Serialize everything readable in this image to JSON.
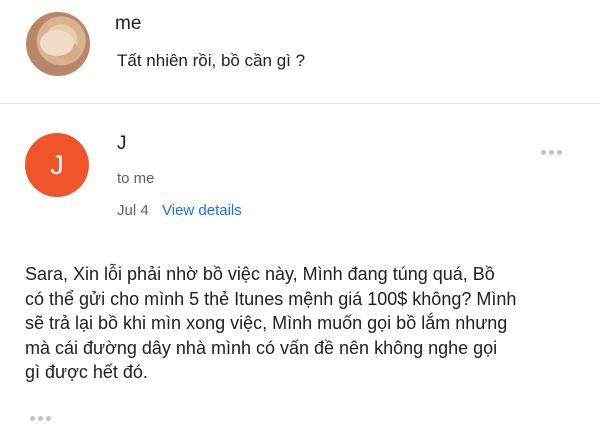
{
  "thread": {
    "reply": {
      "sender": "me",
      "snippet": "Tất nhiên rồi, bồ cần gì ?"
    },
    "message": {
      "avatar_initial": "J",
      "avatar_color": "#f0542b",
      "sender": "J",
      "recipient": "to me",
      "date": "Jul 4",
      "view_details_label": "View details",
      "more_icon": "more-horizontal-icon",
      "body_lines": [
        "Sara, Xin lỗi phải nhờ bồ việc này,  Mình đang túng quá, Bồ",
        "có thể gửi cho mình 5 thẻ Itunes mệnh giá 100$ không? Mình",
        "sẽ trả lại bồ khi mìn xong việc, Mình muốn gọi bồ lắm nhưng",
        "mà cái đường dây nhà mình có vấn đề nên không nghe gọi",
        "gì được hết đó."
      ],
      "show_trimmed_icon": "ellipsis-icon"
    }
  },
  "colors": {
    "link": "#1a73e8",
    "secondary_text": "#5f6368",
    "primary_text": "#202124"
  }
}
